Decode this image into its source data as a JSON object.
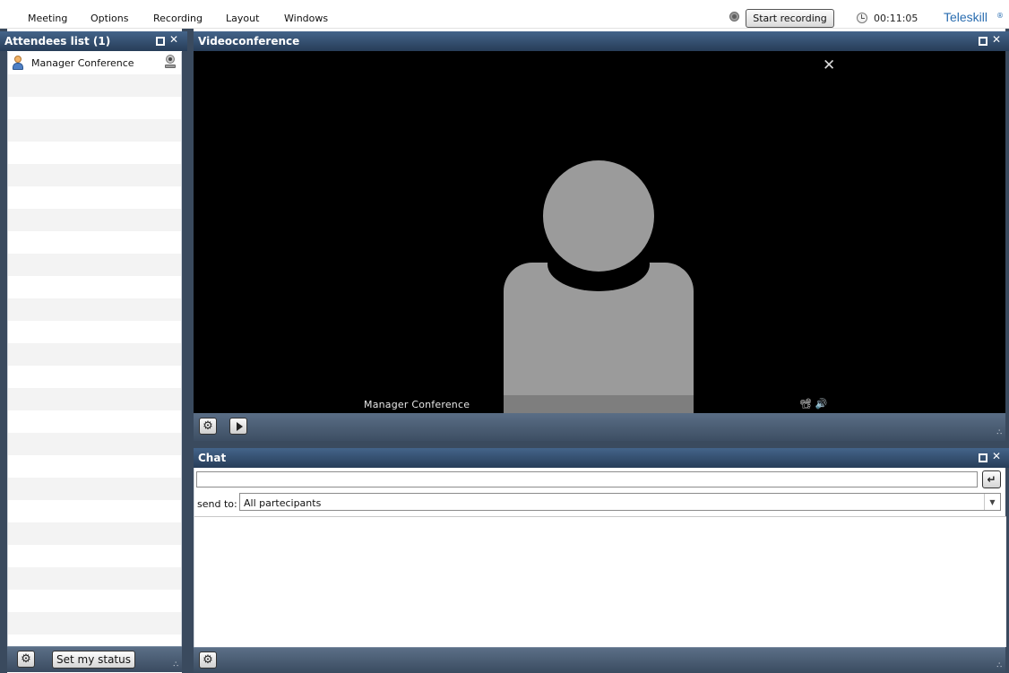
{
  "menubar": {
    "items": [
      "Meeting",
      "Options",
      "Recording",
      "Layout",
      "Windows"
    ],
    "record_button": "Start recording",
    "timer": "00:11:05",
    "brand": "Teleskill",
    "brand_mark": "®"
  },
  "attendees": {
    "title": "Attendees list (1)",
    "items": [
      {
        "name": "Manager Conference"
      }
    ],
    "status_button": "Set my status"
  },
  "video": {
    "title": "Videoconference",
    "participant_name": "Manager Conference",
    "media_icons": "📽 🔊"
  },
  "chat": {
    "title": "Chat",
    "input_value": "",
    "send_icon": "↵",
    "send_to_label": "send to:",
    "send_to_value": "All partecipants"
  },
  "icons": {
    "close": "✕",
    "gear": "⚙",
    "dropdown": "▼",
    "grip": "∴"
  },
  "colors": {
    "header": "#273d58",
    "footer": "#3a4b60",
    "brand": "#2a6db0"
  }
}
